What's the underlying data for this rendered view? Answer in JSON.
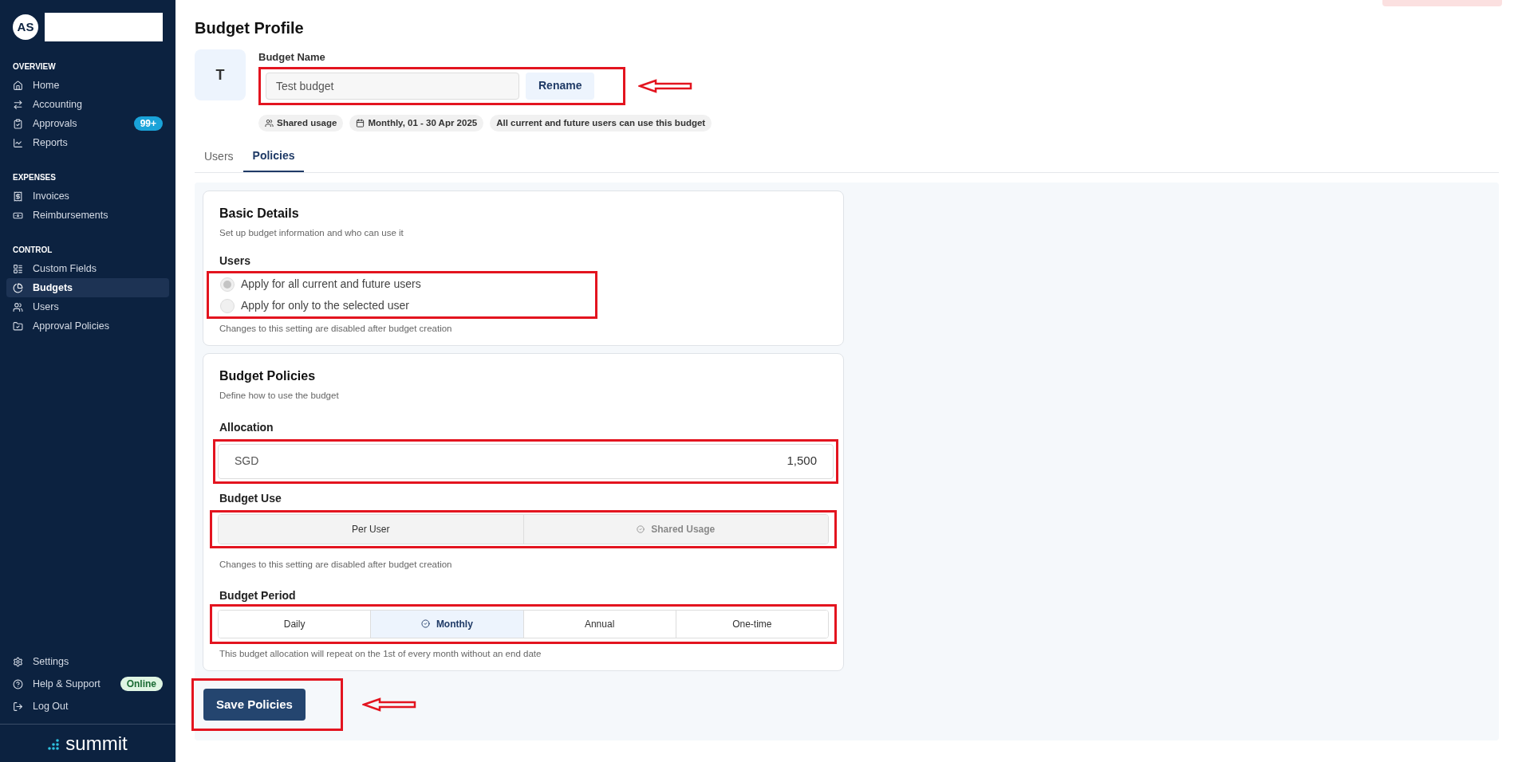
{
  "sidebar": {
    "avatar": "AS",
    "sections": [
      {
        "heading": "OVERVIEW",
        "items": [
          {
            "label": "Home",
            "selected": false
          },
          {
            "label": "Accounting",
            "selected": false
          },
          {
            "label": "Approvals",
            "selected": false,
            "badge": {
              "text": "99+",
              "kind": "count"
            }
          },
          {
            "label": "Reports",
            "selected": false
          }
        ]
      },
      {
        "heading": "EXPENSES",
        "items": [
          {
            "label": "Invoices",
            "selected": false
          },
          {
            "label": "Reimbursements",
            "selected": false
          }
        ]
      },
      {
        "heading": "CONTROL",
        "items": [
          {
            "label": "Custom Fields",
            "selected": false
          },
          {
            "label": "Budgets",
            "selected": true
          },
          {
            "label": "Users",
            "selected": false
          },
          {
            "label": "Approval Policies",
            "selected": false
          }
        ]
      }
    ],
    "footer": [
      {
        "label": "Settings"
      },
      {
        "label": "Help & Support",
        "badge": {
          "text": "Online",
          "kind": "status"
        }
      },
      {
        "label": "Log Out"
      }
    ],
    "logo": "summit"
  },
  "page": {
    "title": "Budget Profile",
    "avatar": "T",
    "name_label": "Budget Name",
    "name_value": "Test budget",
    "rename": "Rename",
    "chips": [
      {
        "text": "Shared usage",
        "kind": "users"
      },
      {
        "text": "Monthly, 01 - 30 Apr 2025",
        "kind": "calendar"
      },
      {
        "text": "All current and future users can use this budget",
        "kind": "plain"
      }
    ],
    "tabs": [
      {
        "label": "Users",
        "selected": false
      },
      {
        "label": "Policies",
        "selected": true
      }
    ]
  },
  "basic": {
    "title": "Basic Details",
    "subtitle": "Set up budget information and who can use it",
    "users_label": "Users",
    "options": [
      {
        "label": "Apply for all current and future users",
        "selected": true
      },
      {
        "label": "Apply for only to the selected user",
        "selected": false
      }
    ],
    "disabled": true,
    "note": "Changes to this setting are disabled after budget creation"
  },
  "policies": {
    "title": "Budget Policies",
    "subtitle": "Define how to use the budget",
    "allocation_label": "Allocation",
    "currency": "SGD",
    "amount": "1,500",
    "use_label": "Budget Use",
    "use_disabled": true,
    "use_options": [
      {
        "label": "Per User",
        "selected": false
      },
      {
        "label": "Shared Usage",
        "selected": true
      }
    ],
    "use_note": "Changes to this setting are disabled after budget creation",
    "period_label": "Budget Period",
    "period_options": [
      {
        "label": "Daily",
        "selected": false
      },
      {
        "label": "Monthly",
        "selected": true
      },
      {
        "label": "Annual",
        "selected": false
      },
      {
        "label": "One-time",
        "selected": false
      }
    ],
    "period_note": "This budget allocation will repeat on the 1st of every month without an end date"
  },
  "save": "Save Policies"
}
